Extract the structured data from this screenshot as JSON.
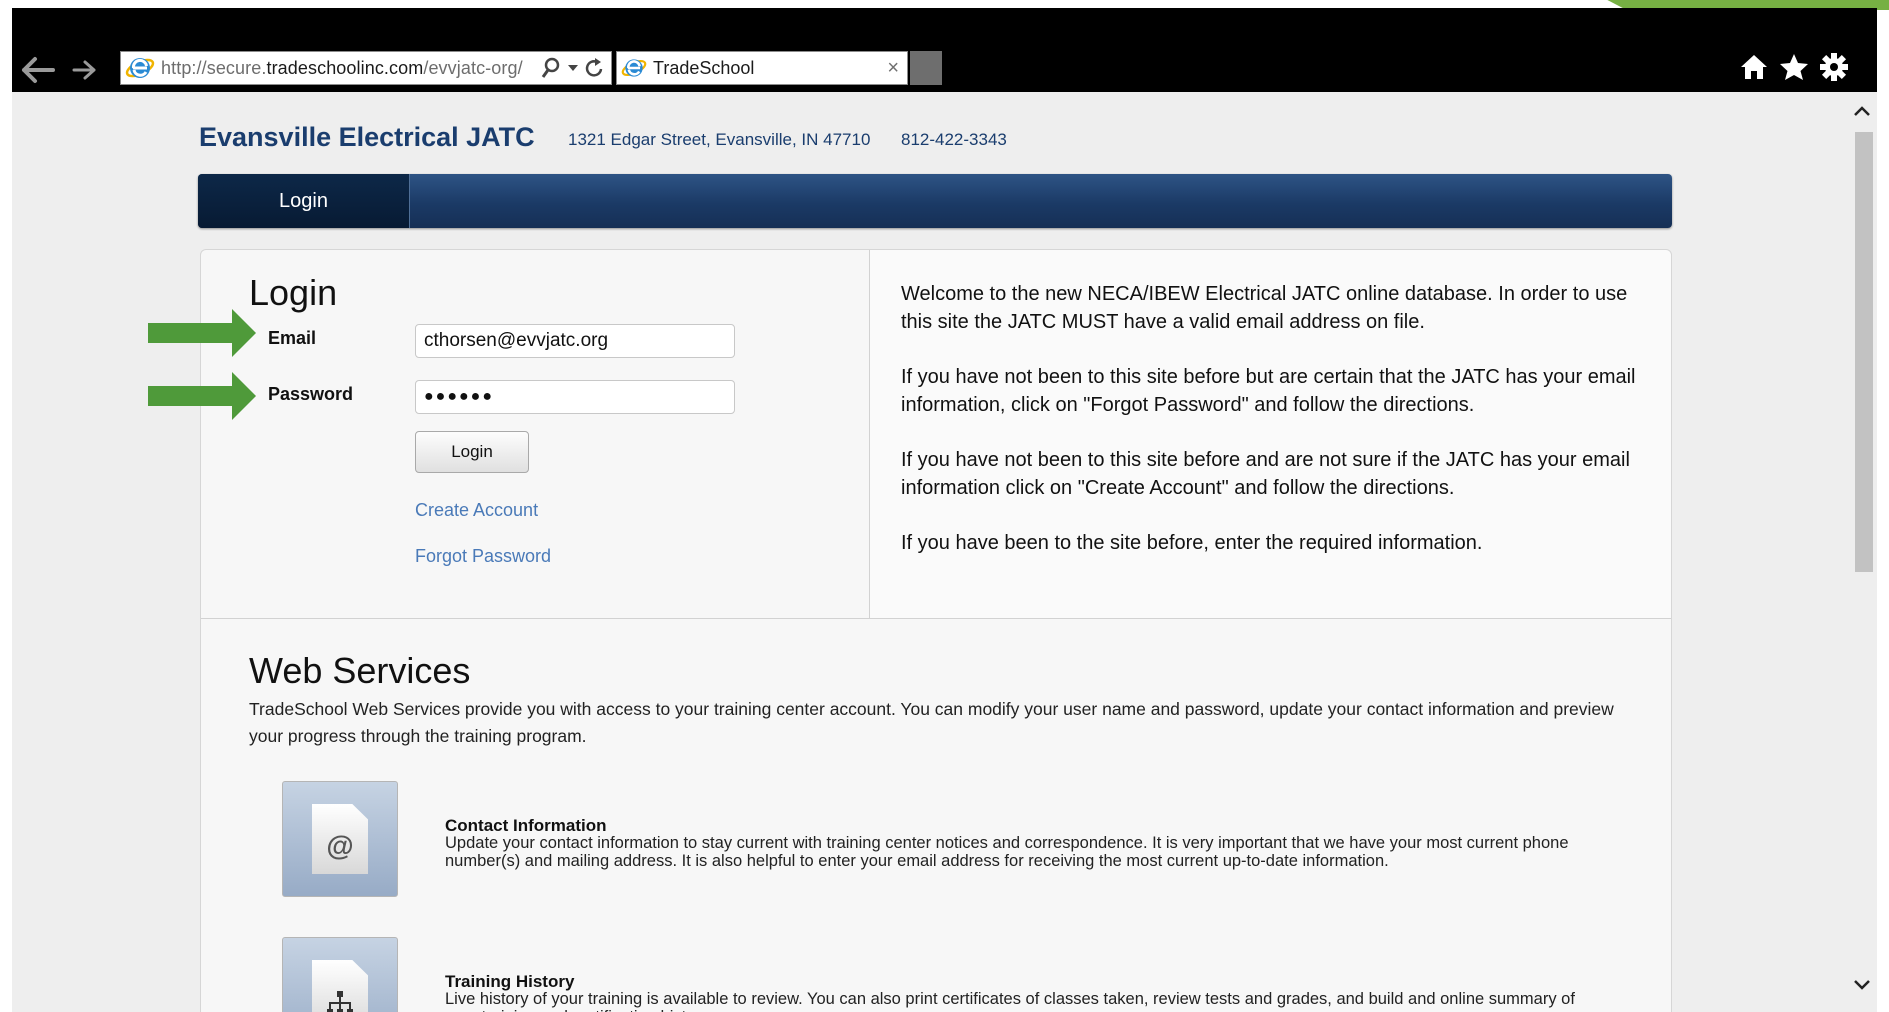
{
  "browser": {
    "url_prefix": "http://secure.",
    "url_domain": "tradeschoolinc.com",
    "url_path": "/evvjatc-org/",
    "tab_title": "TradeSchool",
    "tab_close": "×"
  },
  "site": {
    "title": "Evansville Electrical JATC",
    "address": "1321 Edgar Street, Evansville, IN 47710",
    "phone": "812-422-3343"
  },
  "nav": {
    "login_tab": "Login"
  },
  "login": {
    "heading": "Login",
    "email_label": "Email",
    "email_value": "cthorsen@evvjatc.org",
    "password_label": "Password",
    "password_value": "●●●●●●",
    "login_button": "Login",
    "create_account": "Create Account",
    "forgot_password": "Forgot Password"
  },
  "welcome": {
    "p1": "Welcome to the new NECA/IBEW Electrical JATC online database. In order to use this site the JATC MUST have a valid email address on file.",
    "p2": "If you have not been to this site before but are certain that the JATC has your email information, click on \"Forgot Password\" and follow the directions.",
    "p3": "If you have not been to this site before and are not sure if the JATC has your email information click on \"Create Account\" and follow the directions.",
    "p4": "If you have been to the site before, enter the required information."
  },
  "web_services": {
    "heading": "Web Services",
    "description": "TradeSchool Web Services provide you with access to your training center account. You can modify your user name and password, update your contact information and preview your progress through the training program.",
    "items": [
      {
        "title": "Contact Information",
        "text": "Update your contact information to stay current with training center notices and correspondence. It is very important that we have your most current phone number(s) and mailing address. It is also helpful to enter your email address for receiving the most current up-to-date information.",
        "icon": "contact-document-icon"
      },
      {
        "title": "Training History",
        "text": "Live history of your training is available to review. You can also print certificates of classes taken, review tests and grades, and build and online summary of your training and certification history.",
        "icon": "training-history-icon"
      }
    ]
  },
  "colors": {
    "brand_blue": "#1a3d6e",
    "nav_gradient_top": "#2e5485",
    "link": "#4a7ab8",
    "annotation_arrow": "#4f9a3a"
  }
}
